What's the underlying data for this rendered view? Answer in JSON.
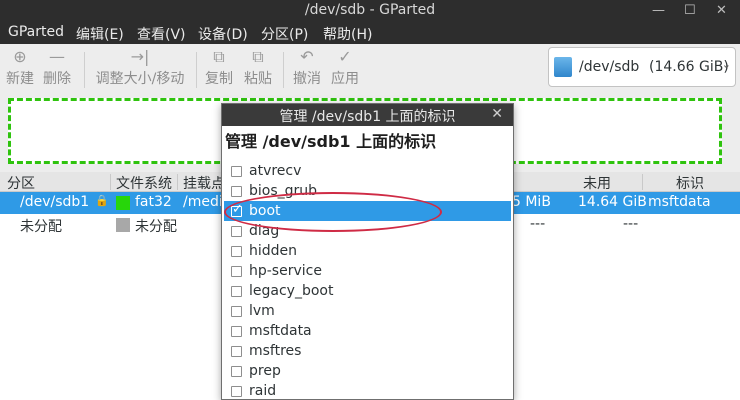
{
  "window": {
    "title": "/dev/sdb - GParted",
    "controls": {
      "minimize": "—",
      "maximize": "☐",
      "close": "✕"
    }
  },
  "menubar": [
    "GParted",
    "编辑(E)",
    "查看(V)",
    "设备(D)",
    "分区(P)",
    "帮助(H)"
  ],
  "toolbar": {
    "new": {
      "icon": "⊕",
      "label": "新建"
    },
    "delete": {
      "icon": "—",
      "label": "删除"
    },
    "resize": {
      "icon": "→|",
      "label": "调整大小/移动"
    },
    "copy": {
      "icon": "⧉",
      "label": "复制"
    },
    "paste": {
      "icon": "⧉",
      "label": "粘贴"
    },
    "undo": {
      "icon": "↶",
      "label": "撤消"
    },
    "apply": {
      "icon": "✓",
      "label": "应用"
    }
  },
  "device": {
    "name": "/dev/sdb",
    "size": "(14.66 GiB)",
    "arrow": "⌄"
  },
  "table": {
    "headers": [
      "分区",
      "文件系统",
      "挂载点",
      "未用",
      "标识"
    ],
    "rows": [
      {
        "partition": "/dev/sdb1",
        "filesystem": "fat32",
        "fs_color": "#27d60a",
        "mount": "/medi",
        "size_tail": "5 MiB",
        "unused": "14.64 GiB",
        "flags": "msftdata"
      },
      {
        "partition": "未分配",
        "filesystem": "未分配",
        "fs_color": "#a8a8a8",
        "mount": "",
        "size_tail": "---",
        "unused": "---",
        "flags": ""
      }
    ]
  },
  "dialog": {
    "title": "管理 /dev/sdb1 上面的标识",
    "heading": "管理 /dev/sdb1 上面的标识",
    "close": "✕",
    "flags": [
      {
        "label": "atvrecv",
        "checked": false
      },
      {
        "label": "bios_grub",
        "checked": false
      },
      {
        "label": "boot",
        "checked": true
      },
      {
        "label": "diag",
        "checked": false
      },
      {
        "label": "hidden",
        "checked": false
      },
      {
        "label": "hp-service",
        "checked": false
      },
      {
        "label": "legacy_boot",
        "checked": false
      },
      {
        "label": "lvm",
        "checked": false
      },
      {
        "label": "msftdata",
        "checked": false
      },
      {
        "label": "msftres",
        "checked": false
      },
      {
        "label": "prep",
        "checked": false
      },
      {
        "label": "raid",
        "checked": false
      }
    ]
  }
}
